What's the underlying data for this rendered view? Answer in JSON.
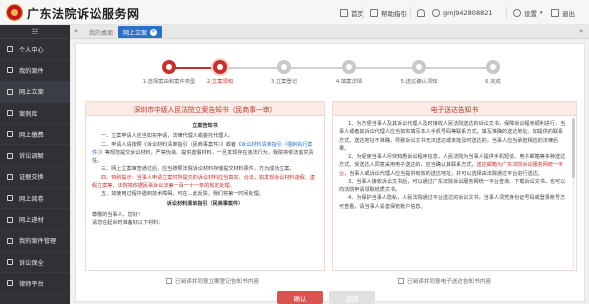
{
  "header": {
    "site_title": "广东法院诉讼服务网",
    "nav": [
      {
        "label": "首页",
        "icon": "home-icon"
      },
      {
        "label": "帮助指引",
        "icon": "help-icon"
      },
      {
        "label": "",
        "icon": "bell-icon"
      },
      {
        "label": "gmj942808821",
        "icon": "user-icon"
      },
      {
        "label": "设置",
        "icon": "gear-icon"
      },
      {
        "label": "退出",
        "icon": "logout-icon"
      }
    ]
  },
  "sidebar": {
    "toggle": "☷",
    "items": [
      {
        "label": "个人中心"
      },
      {
        "label": "我的案件"
      },
      {
        "label": "网上立案"
      },
      {
        "label": "案例库"
      },
      {
        "label": "网上缴费"
      },
      {
        "label": "诉讼调解"
      },
      {
        "label": "证据交换"
      },
      {
        "label": "网上阅卷"
      },
      {
        "label": "网上递材"
      },
      {
        "label": "我的案件管理"
      },
      {
        "label": "诉讼保全"
      },
      {
        "label": "律师平台"
      }
    ]
  },
  "tabs": {
    "left_arrow": "«",
    "right_arrow": "»",
    "items": [
      {
        "label": "我的桌面",
        "active": false
      },
      {
        "label": "网上立案",
        "active": true
      }
    ]
  },
  "steps": [
    {
      "label": "1.选择案由和案件类型",
      "state": "done"
    },
    {
      "label": "2.立案须知",
      "state": "current"
    },
    {
      "label": "3.立案登记",
      "state": "todo"
    },
    {
      "label": "4.填案详情",
      "state": "todo"
    },
    {
      "label": "5.送达确认须知",
      "state": "todo"
    },
    {
      "label": "6.完成",
      "state": "todo"
    }
  ],
  "left_panel": {
    "title": "深圳市中级人民法院立案告知书（民商事一审）",
    "subtitle": "立案告知书",
    "para1": "一、立案申请人应当如实申请，法律代理人或委托代理人。",
    "para2_a": "二、申请人请按照《诉讼材料清单指引（民商事案件）》或者《",
    "para2_link": "诉讼材料清单指引（强制执行案件）",
    "para2_b": "》等规范提交诉讼材料，严禁伪造、提供虚假材料，一旦发现存在违法行为，我院将依法追究责任。",
    "para3": "三、网上立案审查通过后，应当按照法院诉讼材料存储提交材料原件，方为成功立案。",
    "para4_red": "四、特别提示：当事人申请立案时所提交的诉讼材料应当真实、合法，如发现诉讼材料造假、虚假立案等，法院将依据民事诉讼法第一百一十一条的规定处理。",
    "para5": "五、如使用过程中遇到技术障碍，可在...此反馈，我们将第一时间处理。",
    "notice_title": "诉讼材料清单指引（民商事案件）",
    "greeting": "尊敬的当事人，您好！",
    "tail": "请您在起诉时准备好以下材料："
  },
  "right_panel": {
    "title": "电子送达告知书",
    "para1": "1、为方便当事人及其诉讼代理人及时接收人民法院送达的诉讼文书，保障诉讼程序顺利进行，当事人或者其诉讼代理人应当如实填写本人手机号码等联系方式，填写准确的送达地址。如提供的联系方式、送达地址不准确，导致诉讼文书无法送达或未能及时送达的，当事人应当承担相应的法律后果。",
    "para2_a": "2、为促使当事人尽快知悉诉讼程序信息，人民法院为当事人提供手机短信、电子邮箱等多种送达方式。受送达人同意采用电子送达的，应当确认其联系方式，",
    "para2_link": "送达邮箱为广东法院诉讼服务网统一平台",
    "para2_b": "，当事人或诉讼代理人应当提供有效的送达地址，并可以选择由法院通过平台进行送达。",
    "para3": "3、当事人接收诉讼文书后，可以通过广东法院诉讼服务网统一平台查询、下载诉讼文书，也可以向法院申请领取纸质文书。",
    "para4": "4、为保护当事人隐私，人民法院通过平台送达的诉讼文书，当事人须凭身份证号码或登录账号方可查看，请当事人妥善保管账户信息。"
  },
  "left_checkbox": "已阅读并同意立案登记告知书内容",
  "right_checkbox": "已阅读并同意电子送达告知书内容",
  "buttons": {
    "confirm": "确认",
    "back": "返回"
  }
}
